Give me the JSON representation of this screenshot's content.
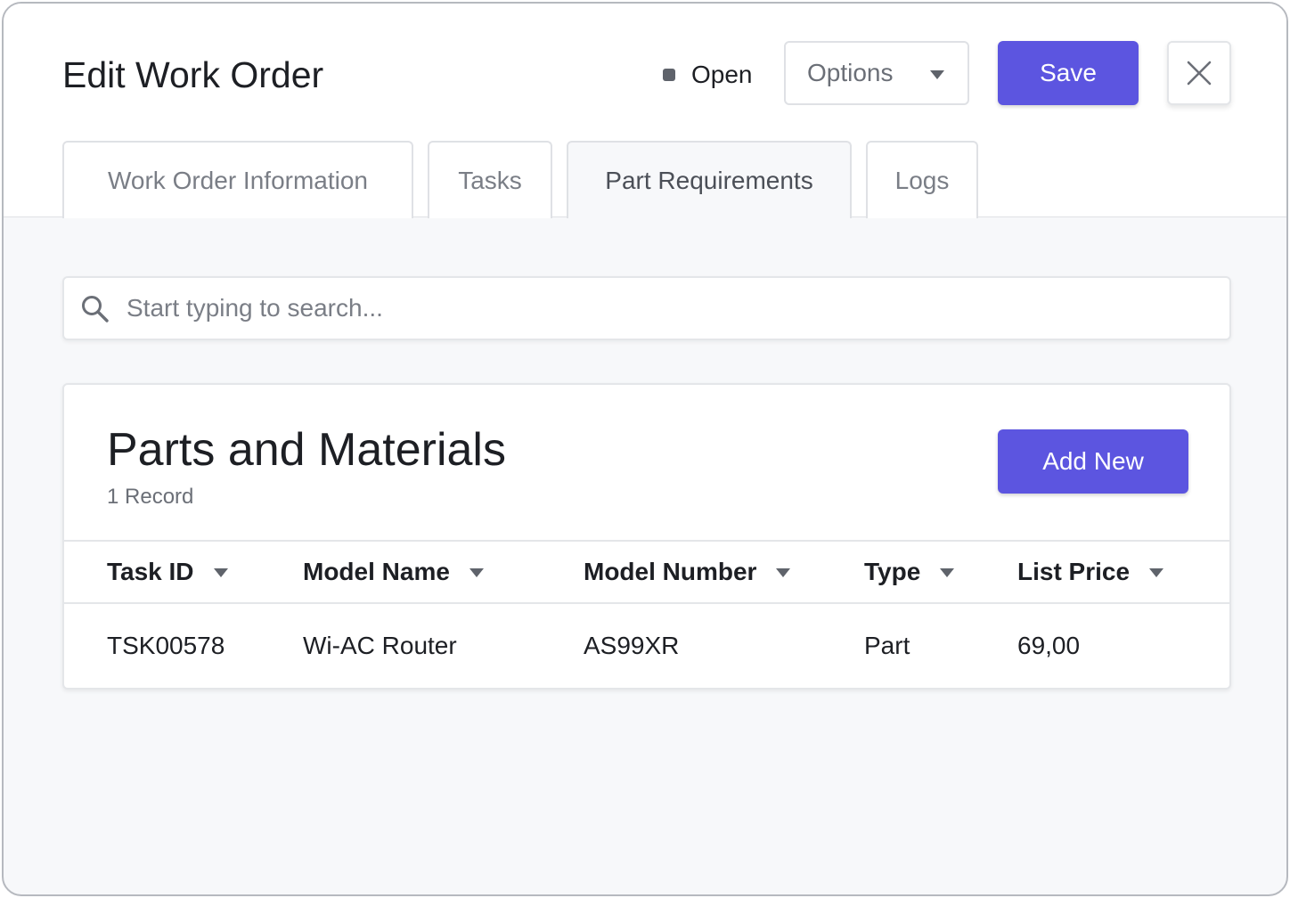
{
  "header": {
    "title": "Edit Work Order",
    "status": "Open",
    "options_label": "Options",
    "save_label": "Save"
  },
  "tabs": [
    {
      "label": "Work Order Information"
    },
    {
      "label": "Tasks"
    },
    {
      "label": "Part Requirements"
    },
    {
      "label": "Logs"
    }
  ],
  "active_tab": "Part Requirements",
  "search": {
    "placeholder": "Start typing to search..."
  },
  "card": {
    "title": "Parts and Materials",
    "record_count": "1 Record",
    "add_label": "Add New"
  },
  "table": {
    "columns": [
      "Task ID",
      "Model Name",
      "Model Number",
      "Type",
      "List Price"
    ],
    "rows": [
      [
        "TSK00578",
        "Wi-AC Router",
        "AS99XR",
        "Part",
        "69,00"
      ]
    ]
  },
  "colors": {
    "accent": "#5c55e0",
    "status_dot": "#5f636b"
  },
  "icons": {
    "search": "search-icon",
    "close": "close-icon",
    "caret": "caret-down-icon"
  }
}
